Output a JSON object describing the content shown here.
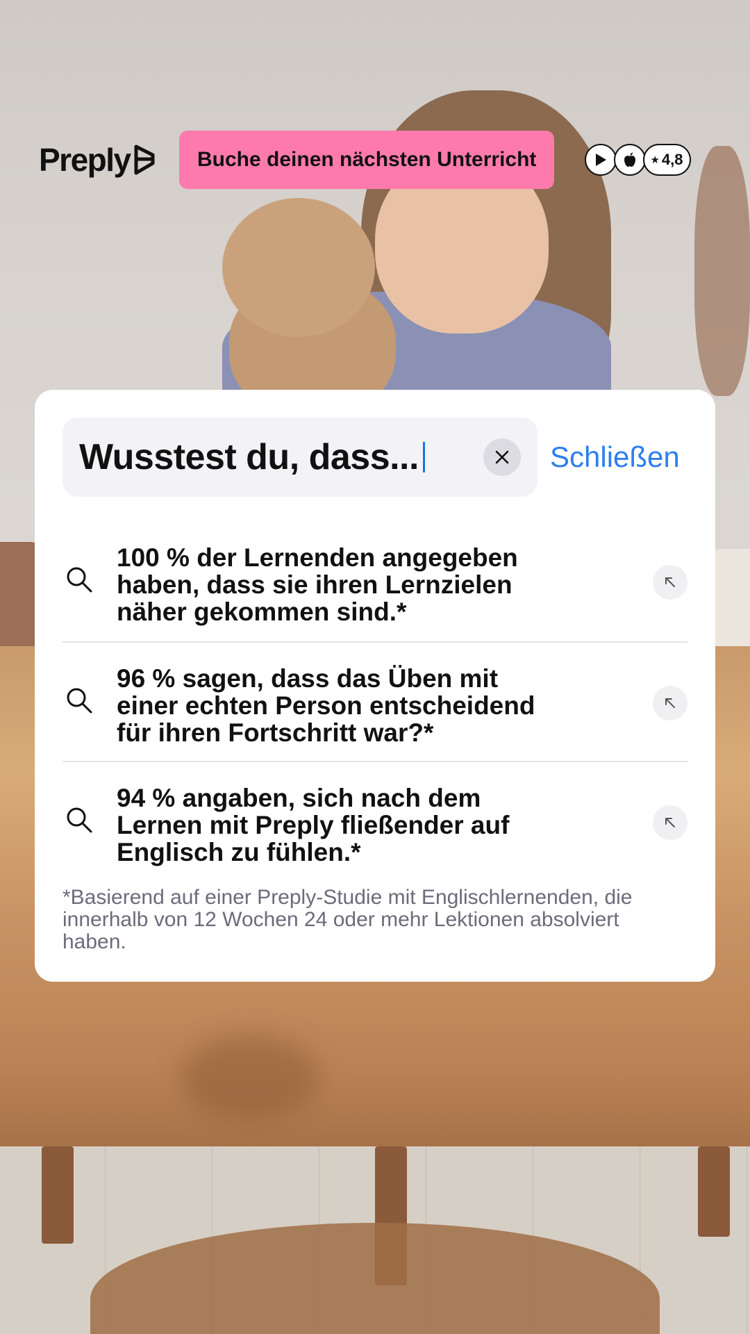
{
  "header": {
    "logo_text": "Preply",
    "cta_label": "Buche deinen nächsten Unterricht",
    "badges": {
      "play_store_icon": "play-icon",
      "app_store_icon": "apple-icon",
      "rating_star": "★",
      "rating_value": "4,8"
    }
  },
  "search": {
    "value": "Wusstest du, dass...",
    "clear_icon": "close-icon",
    "close_label": "Schließen"
  },
  "results": [
    {
      "text": "100 % der Lernenden angegeben haben, dass sie ihren Lernzielen näher gekommen sind.*"
    },
    {
      "text": "96 % sagen, dass das Üben mit einer echten Person entscheidend für ihren Fortschritt war?*"
    },
    {
      "text": "94 % angaben, sich nach dem Lernen mit Preply fließender auf Englisch zu fühlen.*"
    }
  ],
  "footnote": "*Basierend auf einer Preply-Studie mit Englischlernenden, die innerhalb von 12 Wochen 24 oder mehr Lektionen absolviert haben.",
  "colors": {
    "cta": "#ff7aac",
    "link": "#2d7ff0",
    "text": "#111111",
    "muted": "#6b6b7b"
  }
}
